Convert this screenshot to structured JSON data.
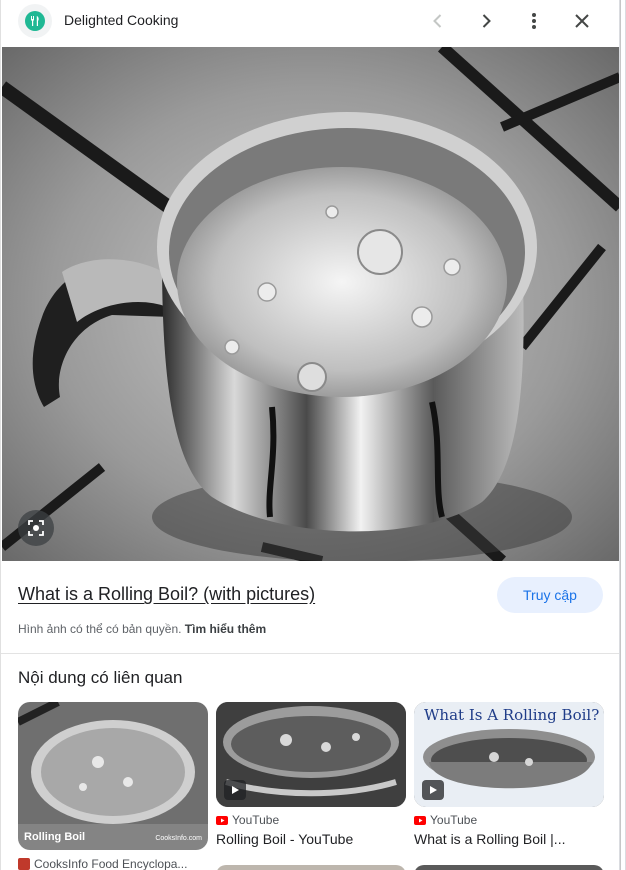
{
  "header": {
    "site_name": "Delighted Cooking",
    "icons": [
      "cutlery-icon",
      "chevron-left-icon",
      "chevron-right-icon",
      "more-vert-icon",
      "close-icon"
    ]
  },
  "result": {
    "title": "What is a Rolling Boil? (with pictures)",
    "visit_label": "Truy cập",
    "copyright_text": "Hình ảnh có thể có bản quyền.",
    "learn_more": "Tìm hiểu thêm"
  },
  "related": {
    "heading": "Nội dung có liên quan",
    "cards": [
      {
        "source": "CooksInfo Food Encyclopa...",
        "thumb_caption": "Rolling Boil",
        "thumb_credit": "CooksInfo.com"
      },
      {
        "source": "YouTube",
        "title": "Rolling Boil - YouTube"
      },
      {
        "source": "YouTube",
        "title": "What is a Rolling Boil |...",
        "thumb_caption": "What Is A Rolling Boil?"
      }
    ]
  },
  "colors": {
    "accent": "#1a73e8",
    "visit_bg": "#e8f0fe",
    "logo_green": "#1fb894",
    "youtube_red": "#ff0000"
  }
}
